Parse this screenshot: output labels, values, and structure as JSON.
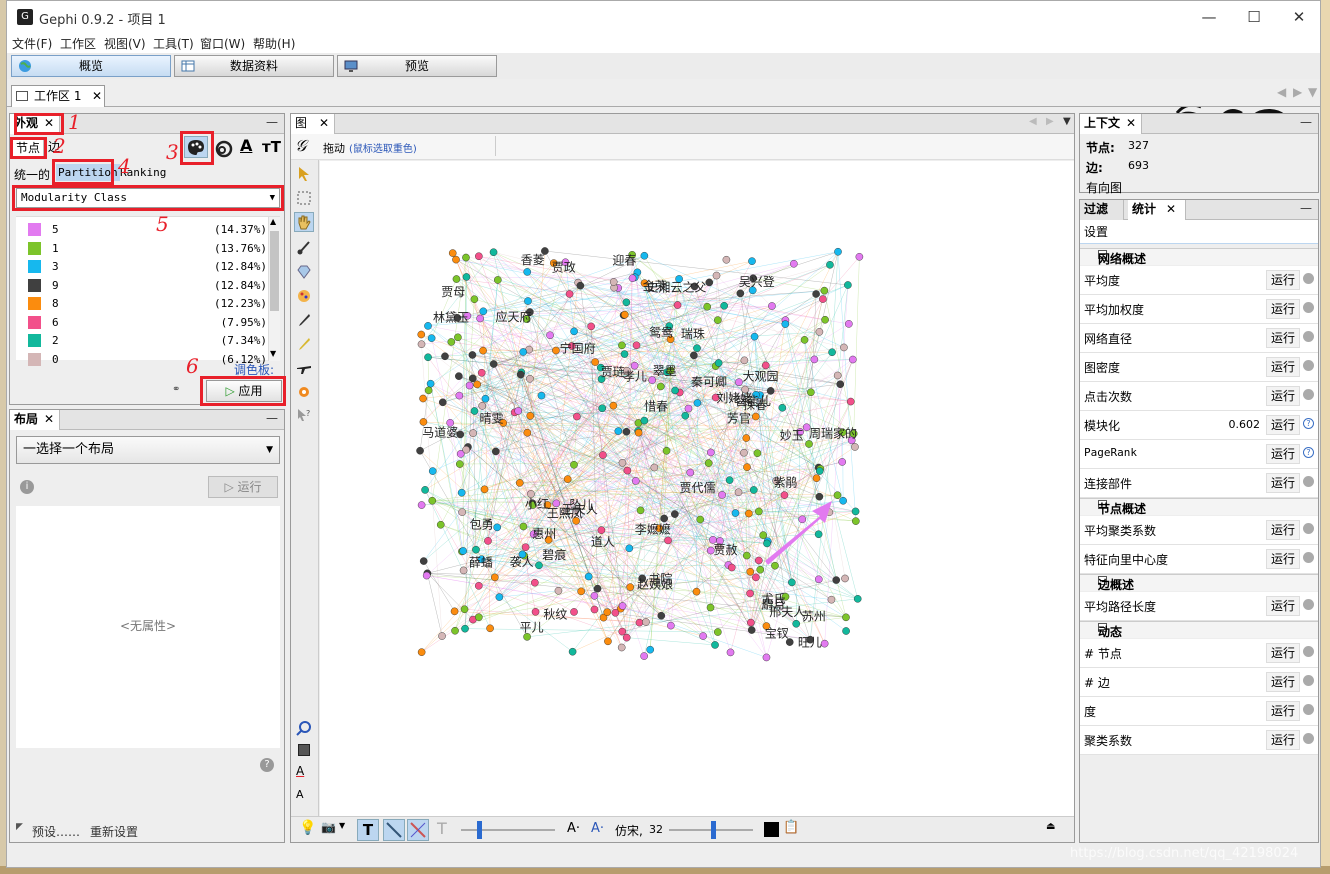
{
  "window": {
    "title": "Gephi 0.9.2 - 项目 1",
    "minimize": "—",
    "maximize": "☐",
    "close": "✕",
    "logo": "gephi-logo-icon"
  },
  "menu": [
    "文件(F)",
    "工作区",
    "视图(V)",
    "工具(T)",
    "窗口(W)",
    "帮助(H)"
  ],
  "toolbar_tabs": [
    "概览",
    "数据资料",
    "预览"
  ],
  "workspace_tab": {
    "label": "工作区 1",
    "close": "✕"
  },
  "appearance": {
    "title": "外观",
    "close": "✕",
    "min": "—",
    "tabs": [
      "节点",
      "边"
    ],
    "modes": [
      "统一的",
      "Partition",
      "Ranking"
    ],
    "attribute": "Modularity Class",
    "legend": [
      {
        "value": "5",
        "pct": "(14.37%)",
        "color": "#e27af0"
      },
      {
        "value": "1",
        "pct": "(13.76%)",
        "color": "#7cc42a"
      },
      {
        "value": "3",
        "pct": "(12.84%)",
        "color": "#16b8ee"
      },
      {
        "value": "9",
        "pct": "(12.84%)",
        "color": "#404040"
      },
      {
        "value": "8",
        "pct": "(12.23%)",
        "color": "#fb8c0e"
      },
      {
        "value": "6",
        "pct": "(7.95%)",
        "color": "#f2508a"
      },
      {
        "value": "2",
        "pct": "(7.34%)",
        "color": "#12b89c"
      },
      {
        "value": "0",
        "pct": "(6.12%)",
        "color": "#d4b6b6"
      }
    ],
    "palette_label": "调色板:",
    "apply": "应用",
    "annotations": [
      "1",
      "2",
      "3",
      "4",
      "5",
      "6"
    ]
  },
  "layout_panel": {
    "title": "布局",
    "close": "✕",
    "min": "—",
    "select": "一选择一个布局",
    "run": "运行",
    "no_props": "<无属性>",
    "presets": "预设……",
    "reset": "重新设置"
  },
  "graph": {
    "title": "图",
    "close": "✕",
    "mode": "拖动",
    "mode_hint": "(鼠标选取重色)",
    "font_name": "仿宋,",
    "font_size": "32",
    "node_labels": [
      "智能儿",
      "旺儿",
      "平儿",
      "周瑞家的",
      "宁国府",
      "王夫人",
      "晴雯",
      "应天府",
      "马道婆",
      "贾代儒",
      "吴兴登",
      "李嬷嬷",
      "大观园",
      "孝儿",
      "惠州",
      "苏州",
      "瑞珠",
      "书院",
      "道人",
      "史湘云之父",
      "刘姥姥",
      "金荣",
      "翠墨",
      "包勇",
      "秦可卿",
      "林黛玉",
      "贾母",
      "薛蟠",
      "香菱",
      "宝钗",
      "袭人",
      "鸳鸯",
      "紫鹃",
      "王熙凤",
      "贾政",
      "贾琏",
      "贾赦",
      "尤氏",
      "妙玉",
      "探春",
      "迎春",
      "惜春",
      "邢夫人",
      "赵姨娘",
      "芳官",
      "小红",
      "坠儿",
      "麝月",
      "秋纹",
      "碧痕"
    ],
    "watermark": "https://blog.csdn.net/qq_42198024"
  },
  "context": {
    "title": "上下文",
    "close": "✕",
    "min": "—",
    "nodes_label": "节点:",
    "nodes": "327",
    "edges_label": "边:",
    "edges": "693",
    "type": "有向图"
  },
  "stats": {
    "tabs": [
      "过滤",
      "统计"
    ],
    "close": "✕",
    "min": "—",
    "settings": "设置",
    "run": "运行",
    "sections": [
      {
        "title": "网络概述",
        "items": [
          {
            "label": "平均度",
            "value": "",
            "help": false
          },
          {
            "label": "平均加权度",
            "value": "",
            "help": false
          },
          {
            "label": "网络直径",
            "value": "",
            "help": false
          },
          {
            "label": "图密度",
            "value": "",
            "help": false
          },
          {
            "label": "点击次数",
            "value": "",
            "help": false
          },
          {
            "label": "模块化",
            "value": "0.602",
            "help": true
          },
          {
            "label": "PageRank",
            "value": "",
            "help": true
          },
          {
            "label": "连接部件",
            "value": "",
            "help": false
          }
        ]
      },
      {
        "title": "节点概述",
        "items": [
          {
            "label": "平均聚类系数",
            "value": "",
            "help": false
          },
          {
            "label": "特征向里中心度",
            "value": "",
            "help": false
          }
        ]
      },
      {
        "title": "边概述",
        "items": [
          {
            "label": "平均路径长度",
            "value": "",
            "help": false
          }
        ]
      },
      {
        "title": "动态",
        "items": [
          {
            "label": "# 节点",
            "value": "",
            "help": false
          },
          {
            "label": "# 边",
            "value": "",
            "help": false
          },
          {
            "label": "度",
            "value": "",
            "help": false
          },
          {
            "label": "聚类系数",
            "value": "",
            "help": false
          }
        ]
      }
    ]
  }
}
